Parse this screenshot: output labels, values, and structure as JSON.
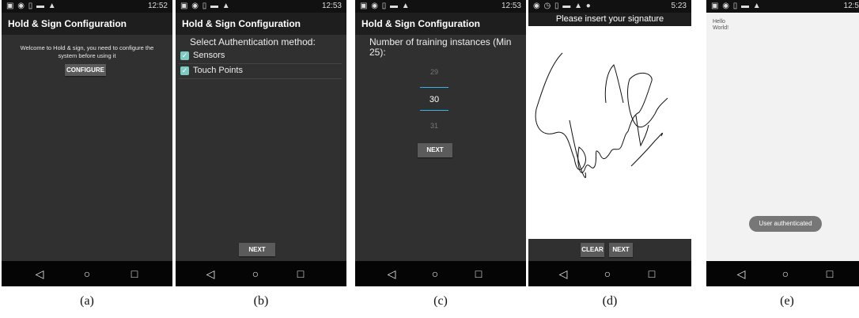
{
  "panels": {
    "a": {
      "status_time": "12:52",
      "title": "Hold & Sign Configuration",
      "message": "Welcome to Hold & sign, you need to configure the system before using it",
      "configure_label": "CONFIGURE",
      "caption": "(a)"
    },
    "b": {
      "status_time": "12:53",
      "title": "Hold & Sign Configuration",
      "heading": "Select Authentication method:",
      "options": [
        {
          "label": "Sensors",
          "checked": true
        },
        {
          "label": "Touch Points",
          "checked": true
        }
      ],
      "next_label": "NEXT",
      "caption": "(b)"
    },
    "c": {
      "status_time": "12:53",
      "title": "Hold & Sign Configuration",
      "heading": "Number of training instances (Min 25):",
      "picker_prev": "29",
      "picker_value": "30",
      "picker_next": "31",
      "next_label": "NEXT",
      "caption": "(c)"
    },
    "d": {
      "status_time": "5:23",
      "heading": "Please insert your signature",
      "clear_label": "CLEAR",
      "next_label": "NEXT",
      "caption": "(d)"
    },
    "e": {
      "status_time": "12:5",
      "hello_text": "Hello World!",
      "toast_text": "User authenticated",
      "caption": "(e)"
    }
  },
  "nav_icons": [
    "back-icon",
    "home-icon",
    "recents-icon"
  ],
  "colors": {
    "screen_bg": "#303030",
    "actionbar": "#1e1e1e",
    "checkbox_accent": "#7ecbc3",
    "picker_divider": "#33b5e5",
    "button_bg": "#5b5b5b"
  }
}
